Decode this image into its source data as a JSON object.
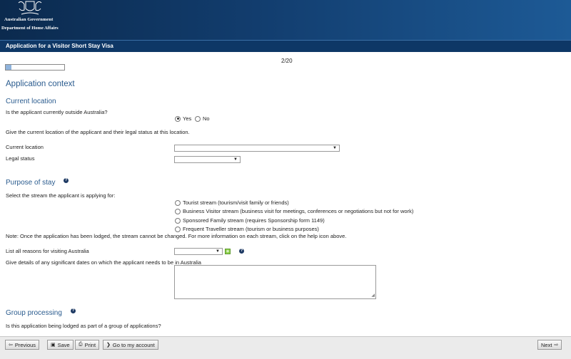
{
  "header": {
    "government": "Australian Government",
    "department": "Department of Home Affairs",
    "form_title": "Application for a Visitor Short Stay Visa"
  },
  "progress": {
    "page_count": "2/20",
    "fraction": 0.1
  },
  "page_title": "Application context",
  "current_location": {
    "heading": "Current location",
    "question": "Is the applicant currently outside Australia?",
    "yes_label": "Yes",
    "no_label": "No",
    "selected": "Yes",
    "instruction": "Give the current location of the applicant and their legal status at this location.",
    "location_label": "Current location",
    "location_value": "",
    "legal_status_label": "Legal status",
    "legal_status_value": ""
  },
  "purpose": {
    "heading": "Purpose of stay",
    "question": "Select the stream the applicant is applying for:",
    "options": [
      "Tourist stream (tourism/visit family or friends)",
      "Business Visitor stream (business visit for meetings, conferences or negotiations but not for work)",
      "Sponsored Family stream (requires Sponsorship form 1149)",
      "Frequent Traveller stream (tourism or business purposes)"
    ],
    "note": "Note: Once the application has been lodged, the stream cannot be changed. For more information on each stream, click on the help icon above.",
    "reasons_label": "List all reasons for visiting Australia",
    "reasons_value": "",
    "dates_label": "Give details of any significant dates on which the applicant needs to be in Australia",
    "dates_value": ""
  },
  "group": {
    "heading": "Group processing",
    "question": "Is this application being lodged as part of a group of applications?"
  },
  "footer": {
    "previous": "Previous",
    "save": "Save",
    "print": "Print",
    "account": "Go to my account",
    "next": "Next"
  },
  "icons": [
    "coat-of-arms-icon",
    "help-icon",
    "add-icon",
    "dropdown-arrow-icon",
    "previous-arrow-icon",
    "save-icon",
    "print-icon",
    "chevron-right-icon",
    "next-arrow-icon"
  ],
  "colors": {
    "banner": "#0b2a4e",
    "title_bar": "#0e3766",
    "heading": "#2a5b8e",
    "add_button": "#8fd14f"
  }
}
